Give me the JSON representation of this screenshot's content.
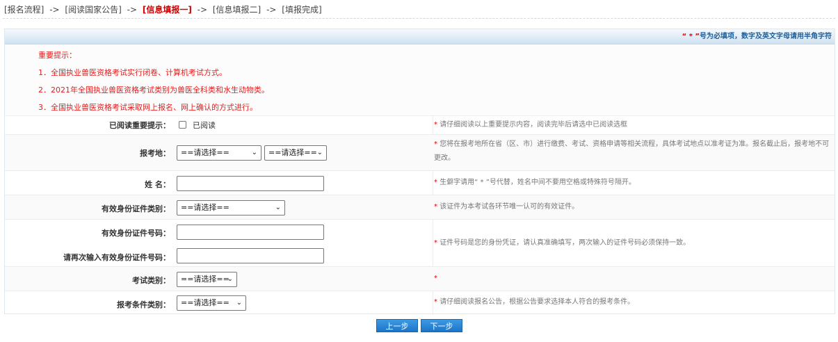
{
  "breadcrumb": {
    "items": [
      "[报名流程]",
      "[阅读国家公告]",
      "[信息填报一]",
      "[信息填报二]",
      "[填报完成]"
    ],
    "separator": "->",
    "active_index": 2
  },
  "notice": {
    "star_text": "“ * ”",
    "text": "号为必填项，数字及英文字母请用半角字符"
  },
  "tips": {
    "title": "重要提示：",
    "lines": [
      "1．全国执业兽医资格考试实行闭卷、计算机考试方式。",
      "2．2021年全国执业兽医资格考试类别为兽医全科类和水生动物类。",
      "3．全国执业兽医资格考试采取网上报名、网上确认的方式进行。"
    ]
  },
  "form": {
    "read": {
      "label": "已阅读重要提示：",
      "checkbox_label": "已阅读",
      "hint": "请仔细阅读以上重要提示内容，阅读完毕后请选中已阅读选框"
    },
    "location": {
      "label": "报考地：",
      "select1": "==请选择==",
      "select2": "==请选择==",
      "hint": "您将在报考地所在省（区、市）进行缴费、考试、资格申请等相关流程，具体考试地点以准考证为准。报名截止后，报考地不可更改。"
    },
    "name": {
      "label": "姓 名：",
      "hint": "生僻字请用“ * ”号代替，姓名中间不要用空格或特殊符号隔开。"
    },
    "id_type": {
      "label": "有效身份证件类别：",
      "select": "==请选择==",
      "hint": "该证件为本考试各环节唯一认可的有效证件。"
    },
    "id_number": {
      "label": "有效身份证件号码：",
      "confirm_label": "请再次输入有效身份证件号码：",
      "hint": "证件号码是您的身份凭证，请认真准确填写，两次输入的证件号码必须保持一致。"
    },
    "exam_type": {
      "label": "考试类别：",
      "select": "==请选择=="
    },
    "condition": {
      "label": "报考条件类别：",
      "select": "==请选择==",
      "hint": "请仔细阅读报名公告，根据公告要求选择本人符合的报考条件。"
    }
  },
  "hint_star": "*",
  "buttons": {
    "prev": "上一步",
    "next": "下一步"
  },
  "colors": {
    "accent_red": "#e02020",
    "button_blue": "#2a86d8",
    "notice_text": "#1f5f99"
  }
}
